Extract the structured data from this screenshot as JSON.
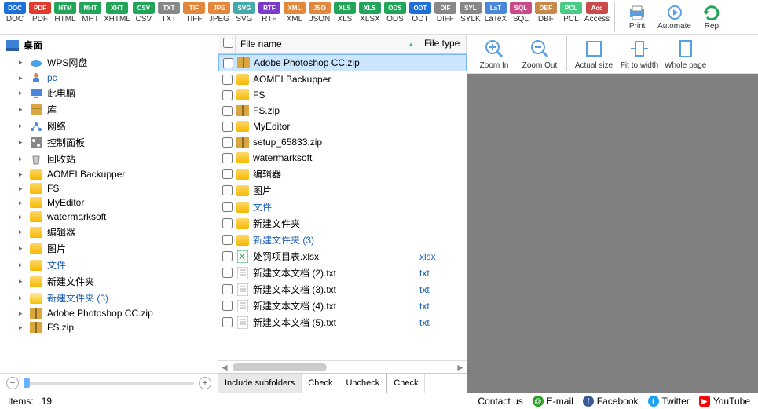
{
  "formats": [
    {
      "label": "DOC",
      "c": "#1e6fd8"
    },
    {
      "label": "PDF",
      "c": "#e23b2e"
    },
    {
      "label": "HTML",
      "c": "#23a559"
    },
    {
      "label": "MHT",
      "c": "#23a559"
    },
    {
      "label": "XHTML",
      "c": "#23a559"
    },
    {
      "label": "CSV",
      "c": "#23a559"
    },
    {
      "label": "TXT",
      "c": "#888"
    },
    {
      "label": "TIFF",
      "c": "#e2873b"
    },
    {
      "label": "JPEG",
      "c": "#e2873b"
    },
    {
      "label": "SVG",
      "c": "#4aa"
    },
    {
      "label": "RTF",
      "c": "#7a3bc9"
    },
    {
      "label": "XML",
      "c": "#e2873b"
    },
    {
      "label": "JSON",
      "c": "#e2873b"
    },
    {
      "label": "XLS",
      "c": "#23a559"
    },
    {
      "label": "XLSX",
      "c": "#23a559"
    },
    {
      "label": "ODS",
      "c": "#23a559"
    },
    {
      "label": "ODT",
      "c": "#1e6fd8"
    },
    {
      "label": "DIFF",
      "c": "#888"
    },
    {
      "label": "SYLK",
      "c": "#888"
    },
    {
      "label": "LaTeX",
      "c": "#4a87d8"
    },
    {
      "label": "SQL",
      "c": "#c94a87"
    },
    {
      "label": "DBF",
      "c": "#c9874a"
    },
    {
      "label": "PCL",
      "c": "#4ac987"
    },
    {
      "label": "Access",
      "c": "#c94a4a"
    }
  ],
  "toolbar": {
    "print": "Print",
    "automate": "Automate",
    "rep": "Rep"
  },
  "tree": {
    "root": "桌面",
    "items": [
      {
        "icon": "cloud",
        "label": "WPS网盘"
      },
      {
        "icon": "user",
        "label": "pc",
        "link": true
      },
      {
        "icon": "monitor",
        "label": "此电脑"
      },
      {
        "icon": "box",
        "label": "库"
      },
      {
        "icon": "network",
        "label": "网络"
      },
      {
        "icon": "panel",
        "label": "控制面板"
      },
      {
        "icon": "recycle",
        "label": "回收站"
      },
      {
        "icon": "folder",
        "label": "AOMEI Backupper"
      },
      {
        "icon": "folder",
        "label": "FS"
      },
      {
        "icon": "folder",
        "label": "MyEditor"
      },
      {
        "icon": "folder",
        "label": "watermarksoft"
      },
      {
        "icon": "folder",
        "label": "编辑器"
      },
      {
        "icon": "folder",
        "label": "图片"
      },
      {
        "icon": "folder",
        "label": "文件",
        "link": true
      },
      {
        "icon": "folder",
        "label": "新建文件夹"
      },
      {
        "icon": "folder-open",
        "label": "新建文件夹 (3)",
        "link": true
      },
      {
        "icon": "zip",
        "label": "Adobe Photoshop CC.zip"
      },
      {
        "icon": "zip",
        "label": "FS.zip"
      }
    ]
  },
  "listHeader": {
    "name": "File name",
    "type": "File type"
  },
  "files": [
    {
      "icon": "zip",
      "name": "Adobe Photoshop CC.zip",
      "type": "",
      "selected": true
    },
    {
      "icon": "folder",
      "name": "AOMEI Backupper",
      "type": ""
    },
    {
      "icon": "folder",
      "name": "FS",
      "type": ""
    },
    {
      "icon": "zip",
      "name": "FS.zip",
      "type": ""
    },
    {
      "icon": "folder",
      "name": "MyEditor",
      "type": ""
    },
    {
      "icon": "zip",
      "name": "setup_65833.zip",
      "type": ""
    },
    {
      "icon": "folder",
      "name": "watermarksoft",
      "type": ""
    },
    {
      "icon": "folder",
      "name": "编辑器",
      "type": ""
    },
    {
      "icon": "folder",
      "name": "图片",
      "type": ""
    },
    {
      "icon": "folder",
      "name": "文件",
      "type": "",
      "link": true
    },
    {
      "icon": "folder",
      "name": "新建文件夹",
      "type": ""
    },
    {
      "icon": "folder",
      "name": "新建文件夹 (3)",
      "type": "",
      "link": true
    },
    {
      "icon": "xlsx",
      "name": "处罚项目表.xlsx",
      "type": "xlsx"
    },
    {
      "icon": "txt",
      "name": "新建文本文档 (2).txt",
      "type": "txt"
    },
    {
      "icon": "txt",
      "name": "新建文本文档 (3).txt",
      "type": "txt"
    },
    {
      "icon": "txt",
      "name": "新建文本文档 (4).txt",
      "type": "txt"
    },
    {
      "icon": "txt",
      "name": "新建文本文档 (5).txt",
      "type": "txt"
    }
  ],
  "actions": {
    "include": "Include subfolders",
    "check": "Check",
    "uncheck": "Uncheck",
    "checkall": "Check"
  },
  "preview": {
    "zoomin": "Zoom In",
    "zoomout": "Zoom Out",
    "actual": "Actual size",
    "fit": "Fit to width",
    "whole": "Whole page"
  },
  "status": {
    "items_label": "Items:",
    "items_count": "19",
    "contact": "Contact us",
    "email": "E-mail",
    "facebook": "Facebook",
    "twitter": "Twitter",
    "youtube": "YouTube"
  }
}
